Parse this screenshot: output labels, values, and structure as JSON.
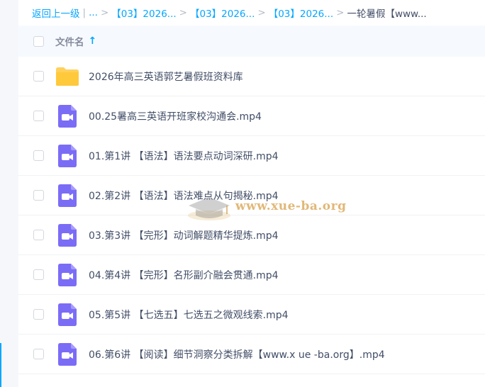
{
  "breadcrumb": {
    "back_label": "返回上一级",
    "divider": "|",
    "ellipsis": "...",
    "separator": ">",
    "items": [
      "【03】2026...",
      "【03】2026...",
      "【03】2026..."
    ],
    "current": "一轮暑假【www..."
  },
  "header": {
    "column_title": "文件名",
    "sort_arrow": "↑"
  },
  "files": [
    {
      "name": "2026年高三英语郭艺暑假班资料库",
      "icon": "folder-icon"
    },
    {
      "name": "00.25暑高三英语开班家校沟通会.mp4",
      "icon": "video-file-icon"
    },
    {
      "name": "01.第1讲 【语法】语法要点动词深研.mp4",
      "icon": "video-file-icon"
    },
    {
      "name": "02.第2讲 【语法】语法难点从句揭秘.mp4",
      "icon": "video-file-icon"
    },
    {
      "name": "03.第3讲 【完形】动词解题精华提炼.mp4",
      "icon": "video-file-icon"
    },
    {
      "name": "04.第4讲 【完形】名形副介融会贯通.mp4",
      "icon": "video-file-icon"
    },
    {
      "name": "05.第5讲 【七选五】七选五之微观线索.mp4",
      "icon": "video-file-icon"
    },
    {
      "name": "06.第6讲 【阅读】细节洞察分类拆解【www.x ue -ba.org】.mp4",
      "icon": "video-file-icon"
    }
  ],
  "watermark": {
    "text": "www.xue-ba.org"
  },
  "colors": {
    "accent": "#06a7ff",
    "folder": "#ffd15b",
    "video": "#7b6cf6",
    "text": "#424e67",
    "header_bg": "#f6faff"
  }
}
